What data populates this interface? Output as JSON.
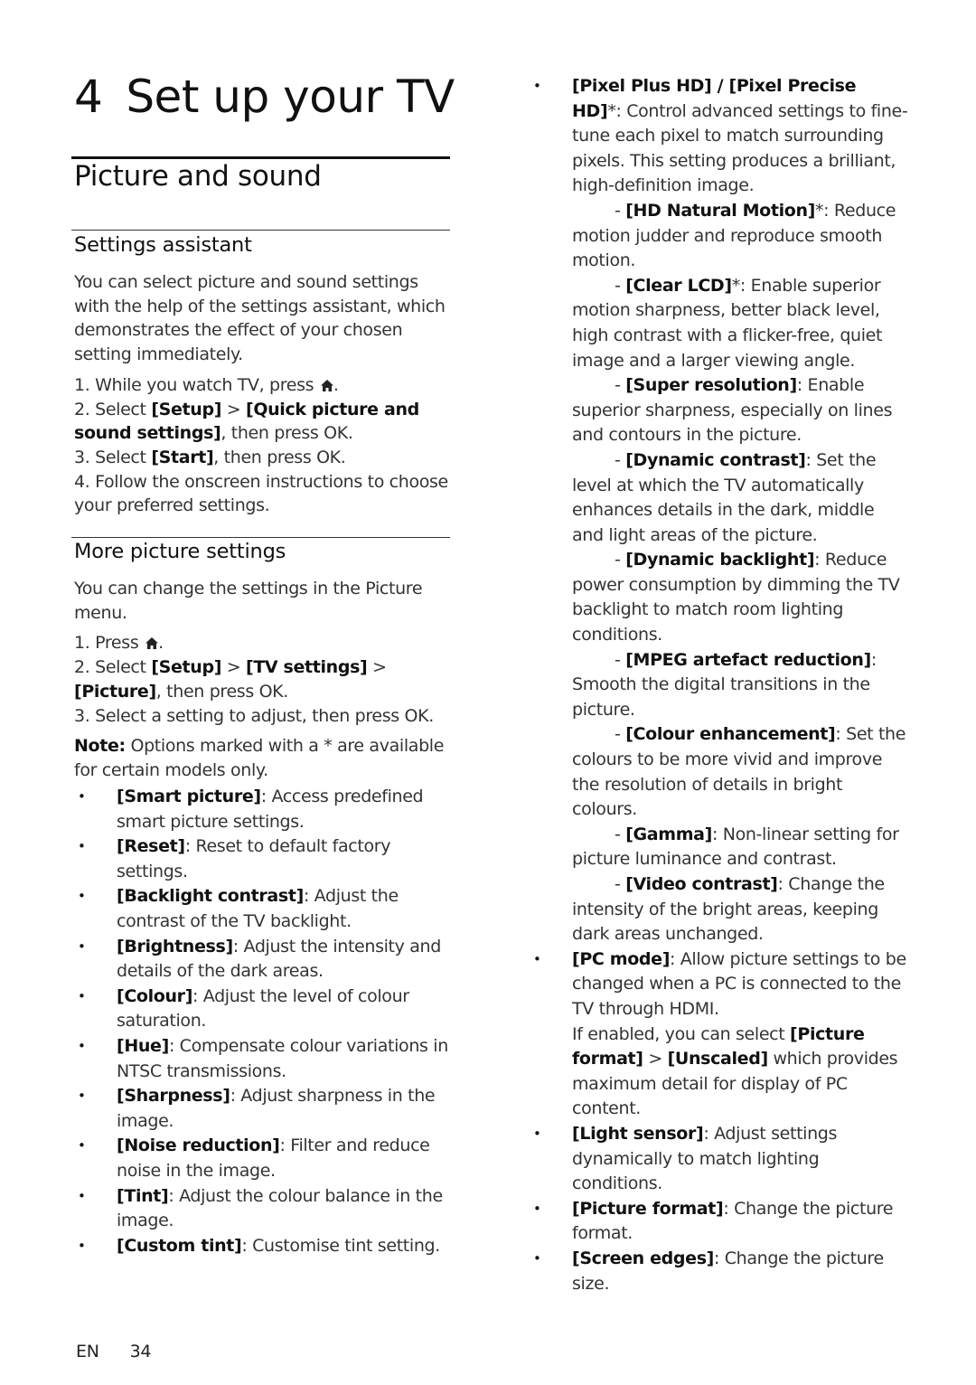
{
  "chapter": {
    "number": "4",
    "title": "Set up your TV"
  },
  "section": {
    "title": "Picture and sound"
  },
  "settings_assistant": {
    "heading": "Settings assistant",
    "intro": "You can select picture and sound settings with the help of the settings assistant, which demonstrates the effect of your chosen setting immediately.",
    "steps": [
      {
        "pre": "1. While you watch TV, press ",
        "icon": "home-icon",
        "post": "."
      },
      {
        "pre": "2. Select ",
        "b1": "[Setup]",
        "mid": " > ",
        "b2": "[Quick picture and sound settings]",
        "post": ", then press OK."
      },
      {
        "pre": "3. Select ",
        "b1": "[Start]",
        "post": ", then press OK."
      },
      {
        "pre": "4. Follow the onscreen instructions to choose your preferred settings."
      }
    ]
  },
  "more_picture": {
    "heading": "More picture settings",
    "intro": "You can change the settings in the Picture menu.",
    "steps": [
      {
        "pre": "1. Press ",
        "icon": "home-icon",
        "post": "."
      },
      {
        "pre": "2. Select ",
        "b1": "[Setup]",
        "mid": " > ",
        "b2": "[TV settings]",
        "mid2": " > ",
        "b3": "[Picture]",
        "post": ", then press OK."
      },
      {
        "pre": "3. Select a setting to adjust, then press OK."
      }
    ],
    "note_label": "Note:",
    "note_text": " Options marked with a * are available for certain models only."
  },
  "left_bullets": [
    {
      "term": "[Smart picture]",
      "desc": ": Access predefined smart picture settings."
    },
    {
      "term": "[Reset]",
      "desc": ": Reset to default factory settings."
    },
    {
      "term": "[Backlight contrast]",
      "desc": ": Adjust the contrast of the TV backlight."
    },
    {
      "term": "[Brightness]",
      "desc": ": Adjust the intensity and details of the dark areas."
    },
    {
      "term": "[Colour]",
      "desc": ": Adjust the level of colour saturation."
    },
    {
      "term": "[Hue]",
      "desc": ": Compensate colour variations in NTSC transmissions."
    },
    {
      "term": "[Sharpness]",
      "desc": ": Adjust sharpness in the image."
    },
    {
      "term": "[Noise reduction]",
      "desc": ": Filter and reduce noise in the image."
    },
    {
      "term": "[Tint]",
      "desc": ": Adjust the colour balance in the image."
    },
    {
      "term": "[Custom tint]",
      "desc": ": Customise tint setting."
    }
  ],
  "right_bullets": {
    "pixel_plus": {
      "term": "[Pixel Plus HD] / [Pixel Precise HD]",
      "asterisk": "*",
      "desc": ": Control advanced settings to fine-tune each pixel to match surrounding pixels. This setting produces a brilliant, high-definition image.",
      "subitems": [
        {
          "term": "[HD Natural Motion]",
          "asterisk": "*",
          "desc": ": Reduce motion judder and reproduce smooth motion."
        },
        {
          "term": "[Clear LCD]",
          "asterisk": "*",
          "desc": ": Enable superior motion sharpness, better black level, high contrast with a flicker-free, quiet image and a larger viewing angle."
        },
        {
          "term": "[Super resolution]",
          "asterisk": "",
          "desc": ": Enable superior sharpness, especially on lines and contours in the picture."
        },
        {
          "term": "[Dynamic contrast]",
          "asterisk": "",
          "desc": ": Set the level at which the TV automatically enhances details in the dark, middle and light areas of the picture."
        },
        {
          "term": "[Dynamic backlight]",
          "asterisk": "",
          "desc": ": Reduce power consumption by dimming the TV backlight to match room lighting conditions."
        },
        {
          "term": "[MPEG artefact reduction]",
          "asterisk": "",
          "desc": ": Smooth the digital transitions in the picture."
        },
        {
          "term": "[Colour enhancement]",
          "asterisk": "",
          "desc": ": Set the colours to be more vivid and improve the resolution of details in bright colours."
        },
        {
          "term": "[Gamma]",
          "asterisk": "",
          "desc": ": Non-linear setting for picture luminance and contrast."
        },
        {
          "term": "[Video contrast]",
          "asterisk": "",
          "desc": ": Change the intensity of the bright areas, keeping dark areas unchanged."
        }
      ]
    },
    "pc_mode": {
      "term": "[PC mode]",
      "desc": ": Allow picture settings to be changed when a PC is connected to the TV through HDMI.",
      "extra_pre": "If enabled, you can select ",
      "extra_b1": "[Picture format]",
      "extra_mid": " > ",
      "extra_b2": "[Unscaled]",
      "extra_post": " which provides maximum detail for display of PC content."
    },
    "others": [
      {
        "term": "[Light sensor]",
        "desc": ": Adjust settings dynamically to match lighting conditions."
      },
      {
        "term": "[Picture format]",
        "desc": ": Change the picture format."
      },
      {
        "term": "[Screen edges]",
        "desc": ": Change the picture size."
      }
    ]
  },
  "footer": {
    "lang": "EN",
    "page": "34"
  },
  "icons": {
    "bullet": "•",
    "dash": "- "
  }
}
